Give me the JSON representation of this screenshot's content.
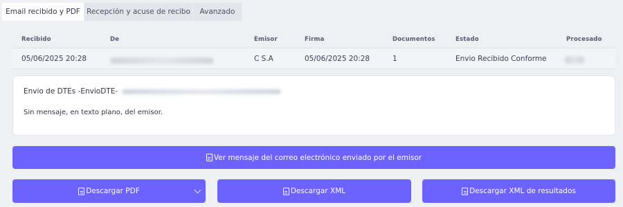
{
  "tabs": [
    {
      "label": "Email recibido y PDF",
      "active": true
    },
    {
      "label": "Recepción y acuse de recibo",
      "active": false
    },
    {
      "label": "Avanzado",
      "active": false
    }
  ],
  "table": {
    "headers": [
      "Recibido",
      "De",
      "Emisor",
      "Firma",
      "Documentos",
      "Estado",
      "Procesado"
    ],
    "row": {
      "recibido": "05/06/2025 20:28",
      "emisor": "C      S.A",
      "firma": "05/06/2025 20:28",
      "documentos": "1",
      "estado": "Envio Recibido Conforme"
    }
  },
  "message": {
    "subject": "Envio de DTEs -EnvioDTE-",
    "body": "Sin mensaje, en texto plano, del emisor."
  },
  "buttons": {
    "view_email": "Ver mensaje del correo electrónico enviado por el emisor",
    "download_pdf": "Descargar PDF",
    "download_xml": "Descargar XML",
    "download_xml_results": "Descargar XML de resultados"
  },
  "colors": {
    "accent": "#6c63ff",
    "background": "#eef0f4"
  }
}
